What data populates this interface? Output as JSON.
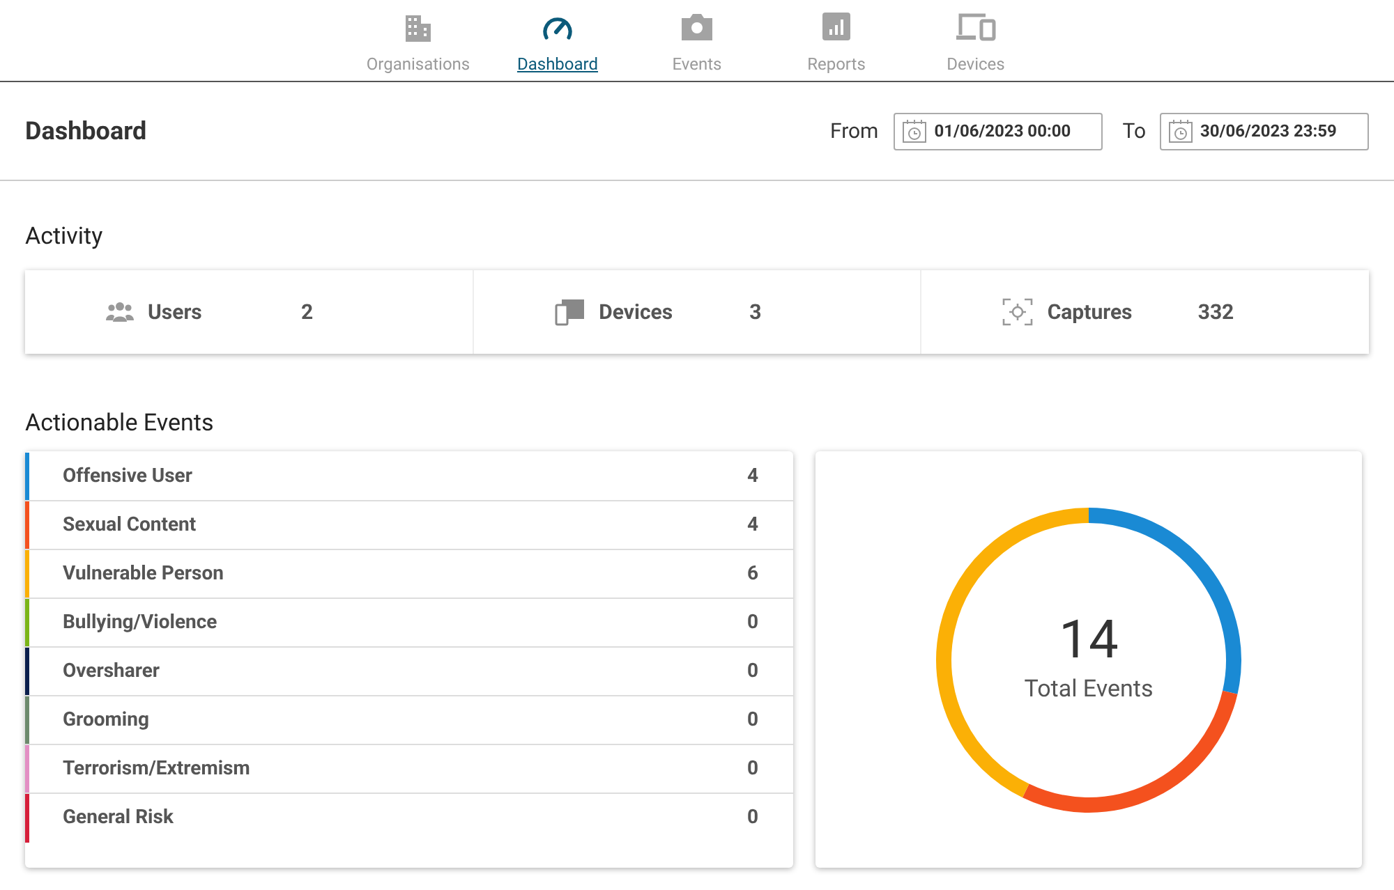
{
  "nav": [
    {
      "label": "Organisations",
      "selected": false
    },
    {
      "label": "Dashboard",
      "selected": true
    },
    {
      "label": "Events",
      "selected": false
    },
    {
      "label": "Reports",
      "selected": false
    },
    {
      "label": "Devices",
      "selected": false
    }
  ],
  "header": {
    "title": "Dashboard",
    "from_label": "From",
    "from_value": "01/06/2023 00:00",
    "to_label": "To",
    "to_value": "30/06/2023 23:59"
  },
  "activity": {
    "title": "Activity",
    "stats": [
      {
        "label": "Users",
        "value": "2"
      },
      {
        "label": "Devices",
        "value": "3"
      },
      {
        "label": "Captures",
        "value": "332"
      }
    ]
  },
  "events": {
    "title": "Actionable Events",
    "items": [
      {
        "label": "Offensive User",
        "count": "4",
        "color": "#1a8ad4"
      },
      {
        "label": "Sexual Content",
        "count": "4",
        "color": "#f4511e"
      },
      {
        "label": "Vulnerable Person",
        "count": "6",
        "color": "#fbb006"
      },
      {
        "label": "Bullying/Violence",
        "count": "0",
        "color": "#7cb518"
      },
      {
        "label": "Oversharer",
        "count": "0",
        "color": "#0b1f4d"
      },
      {
        "label": "Grooming",
        "count": "0",
        "color": "#6d8a6d"
      },
      {
        "label": "Terrorism/Extremism",
        "count": "0",
        "color": "#e38fc4"
      },
      {
        "label": "General Risk",
        "count": "0",
        "color": "#d61f3a"
      }
    ],
    "total": "14",
    "total_label": "Total Events"
  }
}
